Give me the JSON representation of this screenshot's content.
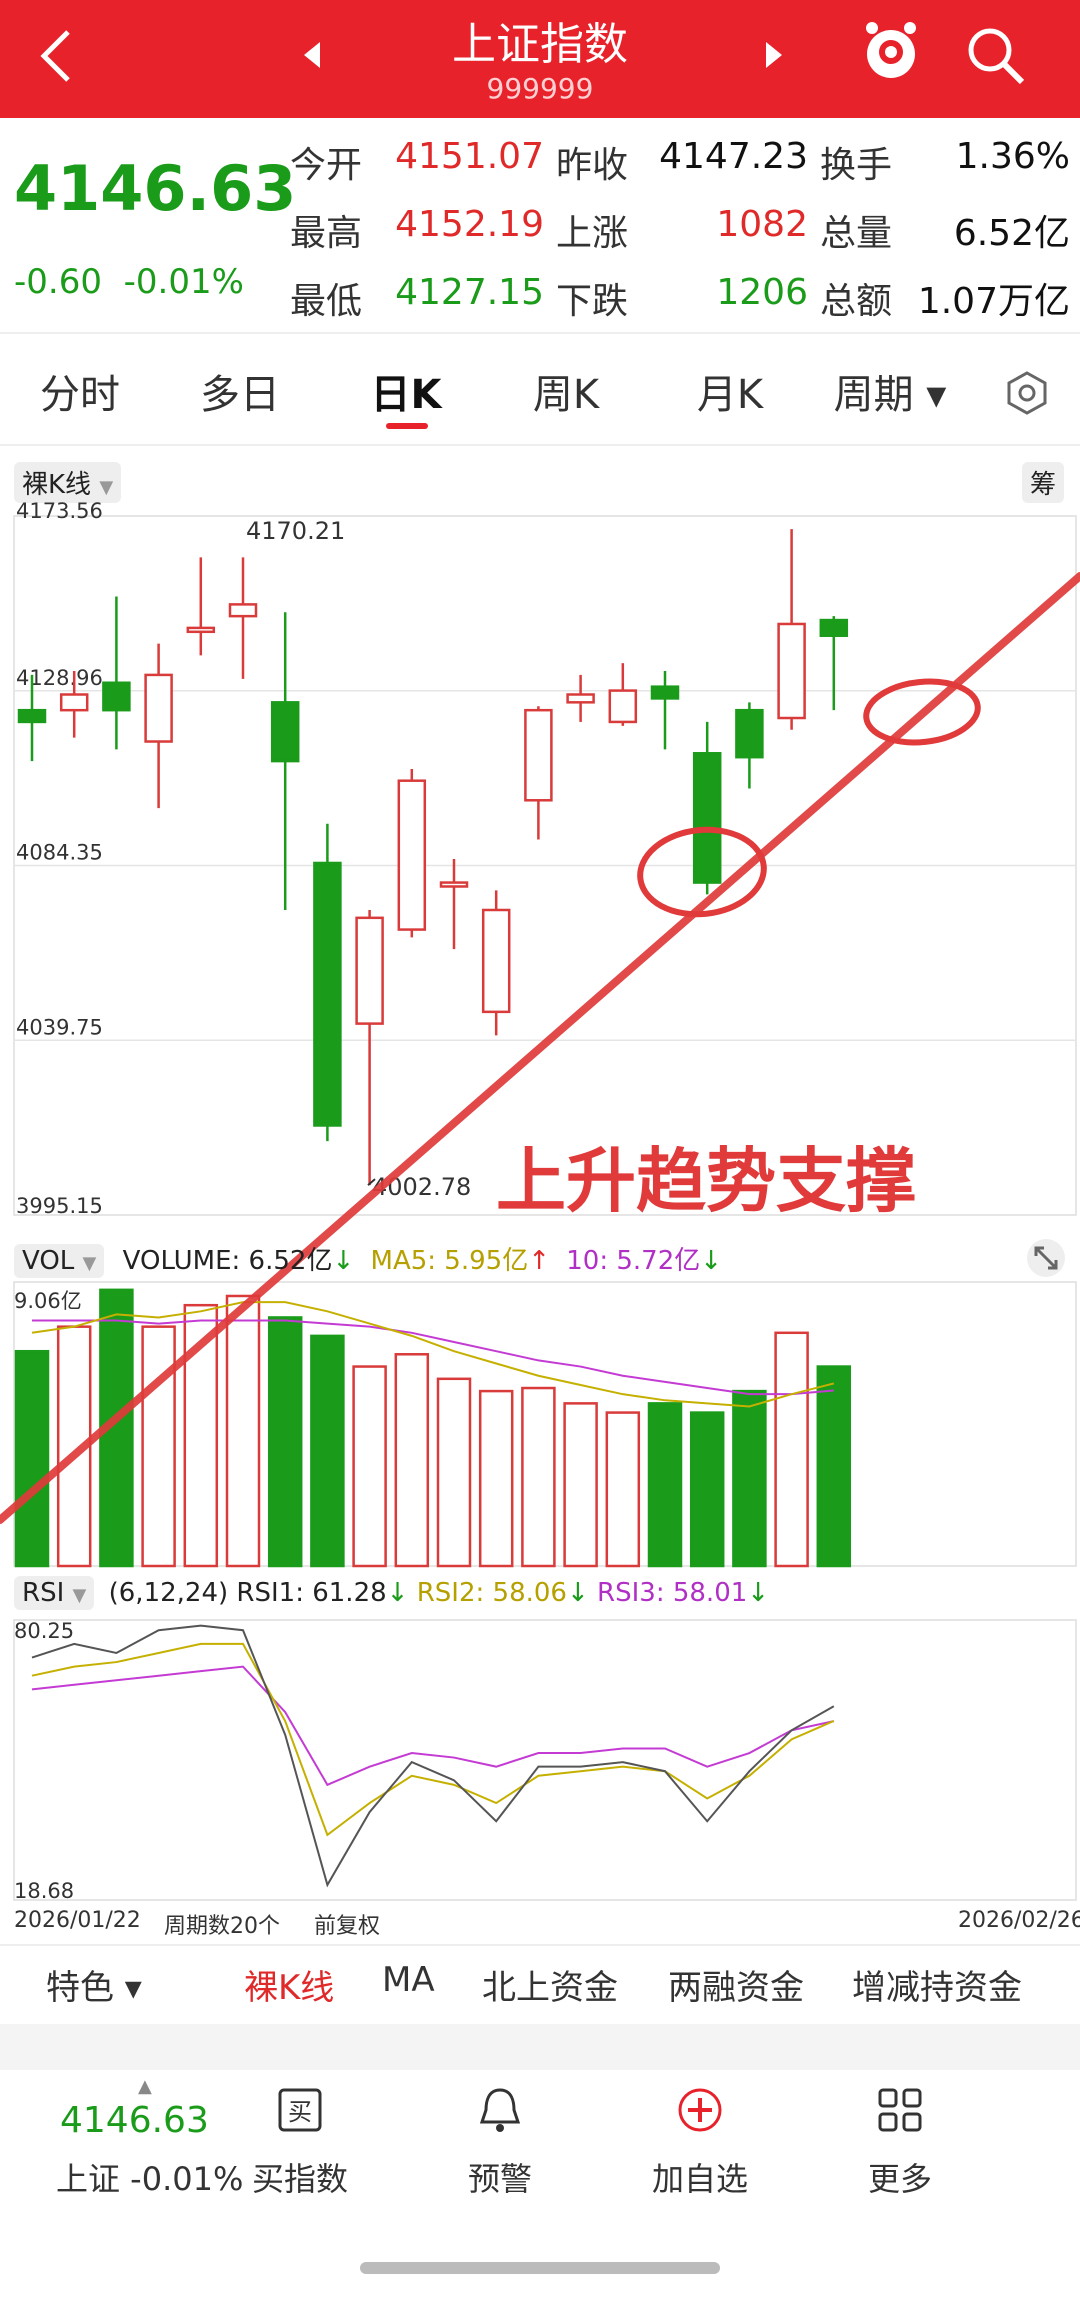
{
  "header": {
    "title": "上证指数",
    "code": "999999"
  },
  "quote": {
    "price": "4146.63",
    "change": "-0.60",
    "change_pct": "-0.01%",
    "rows": [
      [
        {
          "label": "今开",
          "value": "4151.07",
          "color": "red"
        },
        {
          "label": "昨收",
          "value": "4147.23",
          "color": "black"
        },
        {
          "label": "换手",
          "value": "1.36%",
          "color": "black"
        }
      ],
      [
        {
          "label": "最高",
          "value": "4152.19",
          "color": "red"
        },
        {
          "label": "上涨",
          "value": "1082",
          "color": "red"
        },
        {
          "label": "总量",
          "value": "6.52亿",
          "color": "black"
        }
      ],
      [
        {
          "label": "最低",
          "value": "4127.15",
          "color": "green"
        },
        {
          "label": "下跌",
          "value": "1206",
          "color": "green"
        },
        {
          "label": "总额",
          "value": "1.07万亿",
          "color": "black"
        }
      ]
    ]
  },
  "tabs": [
    "分时",
    "多日",
    "日K",
    "周K",
    "月K",
    "周期"
  ],
  "active_tab": "日K",
  "kline": {
    "type_label": "裸K线",
    "chip_label": "筹",
    "price_labels": [
      "4173.56",
      "4128.96",
      "4084.35",
      "4039.75",
      "3995.15"
    ],
    "high_label": "4170.21",
    "low_label": "4002.78",
    "annotation": "上升趋势支撑"
  },
  "volume": {
    "label": "VOL",
    "volume": "VOLUME: 6.52亿",
    "ma5": "MA5: 5.95亿",
    "ma10": "10: 5.72亿",
    "max_label": "9.06亿"
  },
  "rsi": {
    "label": "RSI",
    "params": "(6,12,24)",
    "rsi1": "RSI1: 61.28",
    "rsi2": "RSI2: 58.06",
    "rsi3": "RSI3: 58.01",
    "top": "80.25",
    "bottom": "18.68"
  },
  "footer_axis": {
    "start": "2026/01/22",
    "period": "周期数20个",
    "adjust": "前复权",
    "end": "2026/02/26"
  },
  "bottom_tabs": [
    "特色",
    "裸K线",
    "MA",
    "北上资金",
    "两融资金",
    "增减持资金"
  ],
  "bottom_nav": {
    "price": "4146.63",
    "index_label": "上证 -0.01%",
    "items": [
      "买指数",
      "预警",
      "加自选",
      "更多"
    ]
  },
  "colors": {
    "red": "#e8222b",
    "green": "#1a9b1a",
    "up": "#d93a3a"
  },
  "chart_data": {
    "type": "candlestick",
    "ylim": [
      3995.15,
      4173.56
    ],
    "candles": [
      {
        "o": 4124,
        "c": 4121,
        "h": 4133,
        "l": 4111
      },
      {
        "o": 4124,
        "c": 4128,
        "h": 4134,
        "l": 4117
      },
      {
        "o": 4131,
        "c": 4124,
        "h": 4153,
        "l": 4114
      },
      {
        "o": 4116,
        "c": 4133,
        "h": 4141,
        "l": 4099
      },
      {
        "o": 4144,
        "c": 4145,
        "h": 4163,
        "l": 4138
      },
      {
        "o": 4148,
        "c": 4151,
        "h": 4163,
        "l": 4132
      },
      {
        "o": 4126,
        "c": 4111,
        "h": 4149,
        "l": 4073
      },
      {
        "o": 4085,
        "c": 4018,
        "h": 4095,
        "l": 4014
      },
      {
        "o": 4044,
        "c": 4071,
        "h": 4073,
        "l": 4002.78
      },
      {
        "o": 4068,
        "c": 4106,
        "h": 4109,
        "l": 4066
      },
      {
        "o": 4079,
        "c": 4080,
        "h": 4086,
        "l": 4063
      },
      {
        "o": 4047,
        "c": 4073,
        "h": 4078,
        "l": 4041
      },
      {
        "o": 4101,
        "c": 4124,
        "h": 4125,
        "l": 4091
      },
      {
        "o": 4126,
        "c": 4128,
        "h": 4133,
        "l": 4121
      },
      {
        "o": 4121,
        "c": 4129,
        "h": 4136,
        "l": 4120
      },
      {
        "o": 4130,
        "c": 4127,
        "h": 4134,
        "l": 4114
      },
      {
        "o": 4113,
        "c": 4080,
        "h": 4121,
        "l": 4077
      },
      {
        "o": 4124,
        "c": 4112,
        "h": 4126,
        "l": 4104
      },
      {
        "o": 4122,
        "c": 4146,
        "h": 4170.21,
        "l": 4119
      },
      {
        "o": 4147,
        "c": 4143,
        "h": 4148,
        "l": 4124
      }
    ],
    "volume": {
      "ylim": [
        0,
        9.06
      ],
      "values": [
        7.0,
        7.8,
        9.0,
        7.8,
        8.5,
        8.8,
        8.1,
        7.5,
        6.5,
        6.9,
        6.1,
        5.7,
        5.8,
        5.3,
        5.0,
        5.3,
        5.0,
        5.7,
        7.6,
        6.5
      ],
      "ma5": [
        7.6,
        7.8,
        8.2,
        8.1,
        8.3,
        8.6,
        8.6,
        8.3,
        7.9,
        7.5,
        7.0,
        6.6,
        6.2,
        5.9,
        5.6,
        5.4,
        5.3,
        5.2,
        5.6,
        5.95
      ],
      "ma10": [
        8.0,
        8.0,
        8.0,
        7.9,
        8.0,
        8.0,
        8.0,
        7.9,
        7.8,
        7.6,
        7.3,
        7.0,
        6.7,
        6.5,
        6.2,
        6.0,
        5.8,
        5.6,
        5.6,
        5.72
      ]
    },
    "rsi": {
      "ylim": [
        18.68,
        80.25
      ],
      "rsi1": [
        72,
        75,
        73,
        78,
        79,
        78,
        55,
        22,
        38,
        49,
        45,
        36,
        48,
        48,
        49,
        47,
        36,
        47,
        56,
        61.28
      ],
      "rsi2": [
        68,
        70,
        71,
        73,
        75,
        75,
        58,
        33,
        40,
        46,
        44,
        40,
        46,
        47,
        48,
        47,
        41,
        46,
        54,
        58.06
      ],
      "rsi3": [
        65,
        66,
        67,
        68,
        69,
        70,
        60,
        44,
        48,
        51,
        50,
        48,
        51,
        51,
        52,
        52,
        48,
        51,
        56,
        58.01
      ]
    }
  }
}
